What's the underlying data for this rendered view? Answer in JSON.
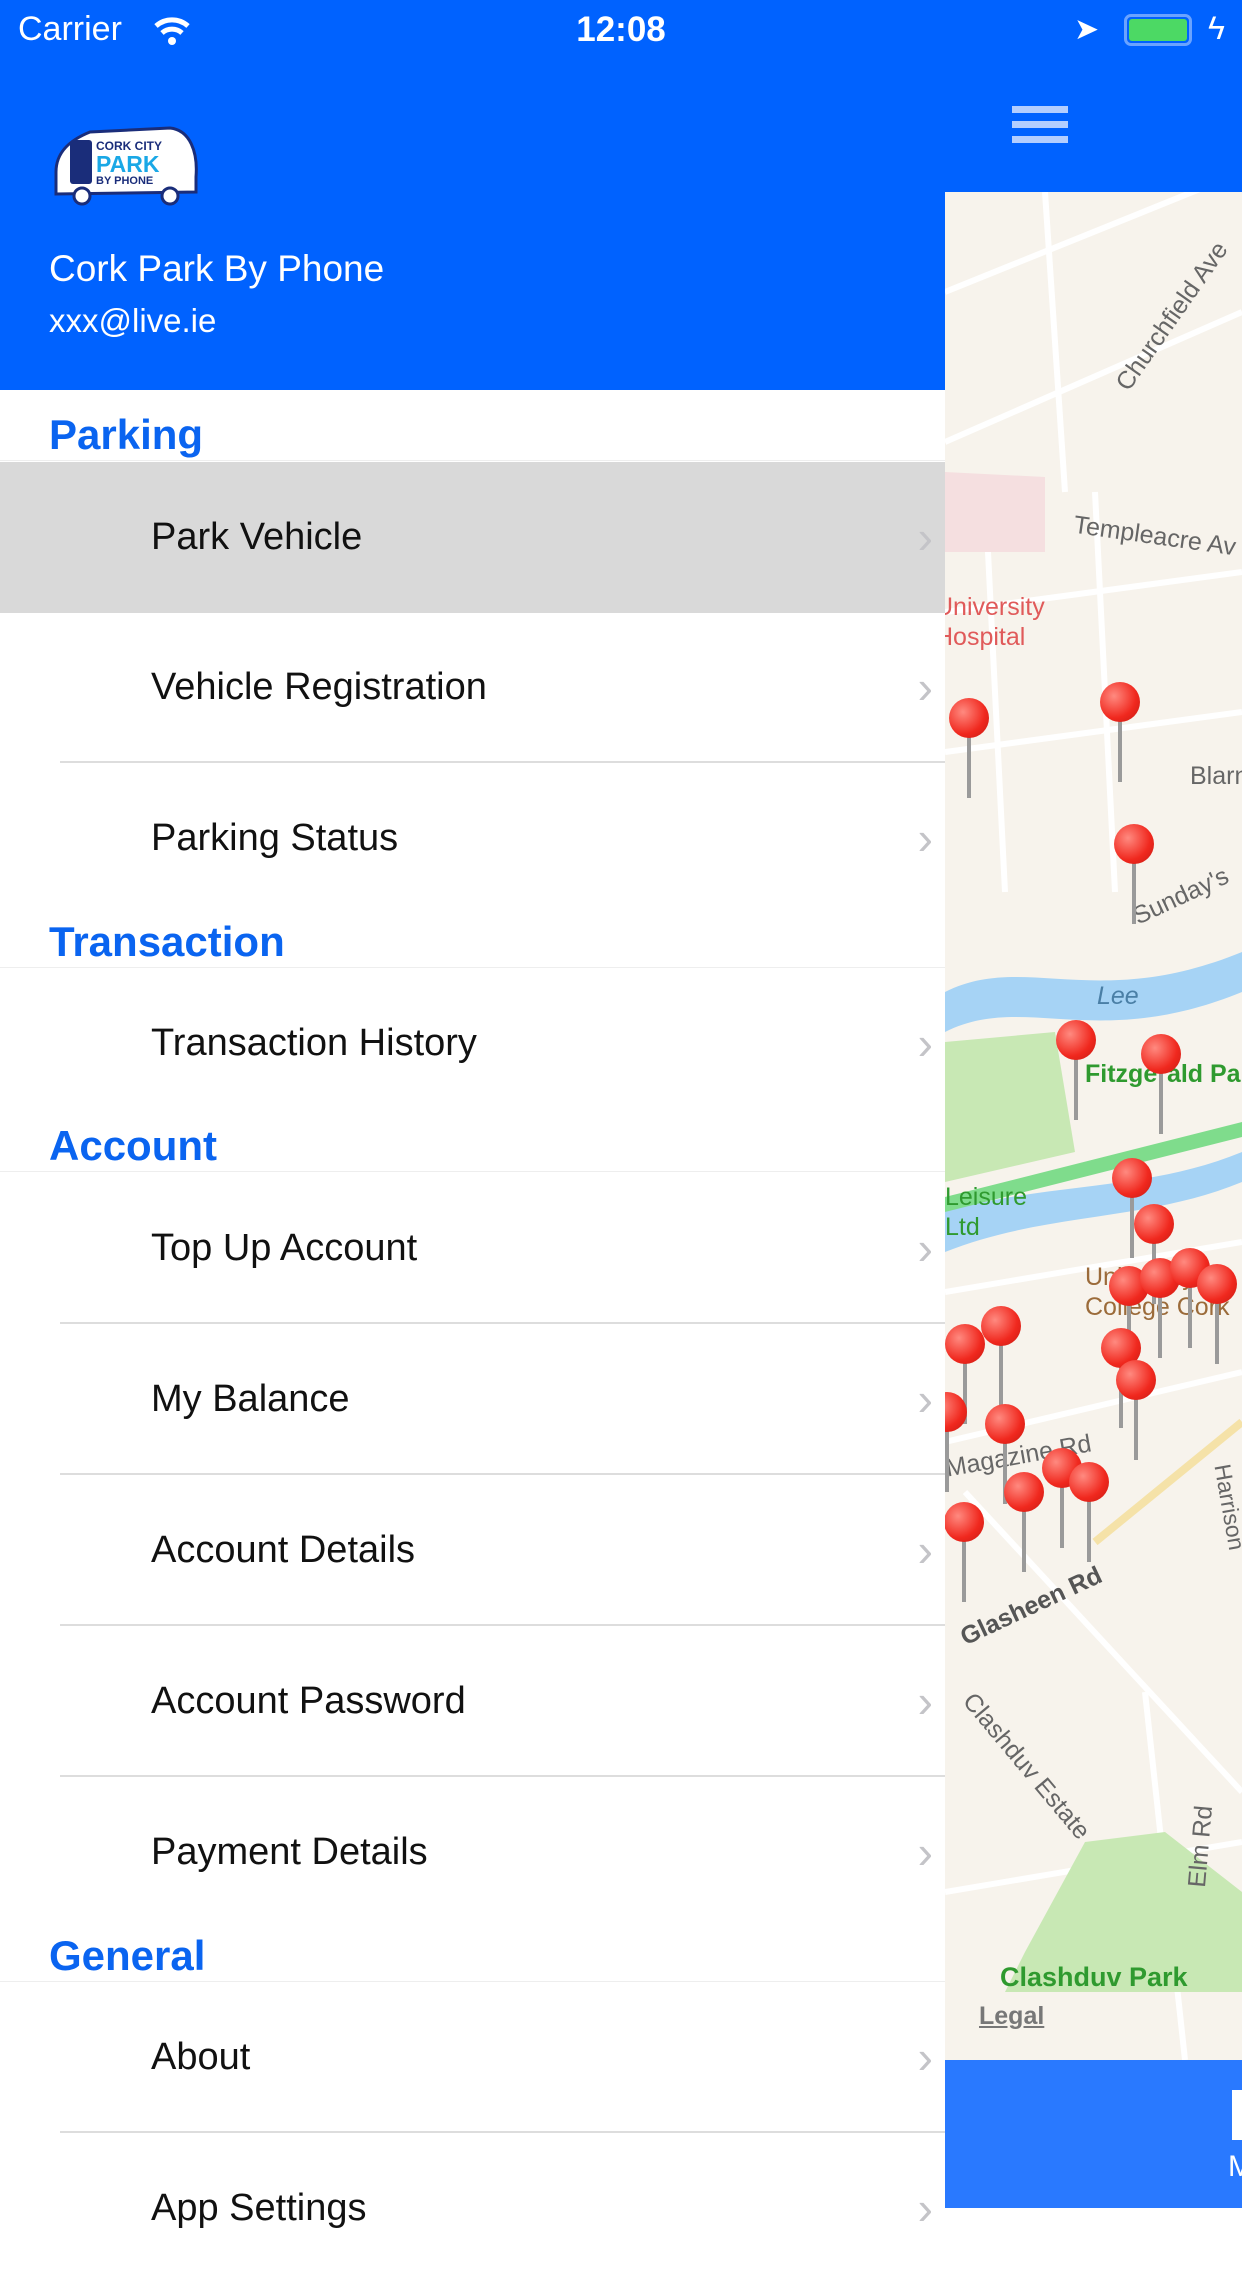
{
  "status_bar": {
    "carrier": "Carrier",
    "time": "12:08",
    "battery_color": "#4cd964"
  },
  "drawer": {
    "app_name": "Cork Park By Phone",
    "email": "xxx@live.ie",
    "logo_text": "CORK CITY PARK BY PHONE",
    "sections": [
      {
        "title": "Parking",
        "items": [
          "Park Vehicle",
          "Vehicle Registration",
          "Parking Status"
        ]
      },
      {
        "title": "Transaction",
        "items": [
          "Transaction History"
        ]
      },
      {
        "title": "Account",
        "items": [
          "Top Up Account",
          "My Balance",
          "Account Details",
          "Account Password",
          "Payment Details"
        ]
      },
      {
        "title": "General",
        "items": [
          "About",
          "App Settings"
        ]
      }
    ],
    "selected_item": "Park Vehicle"
  },
  "map": {
    "labels": [
      "Churchfield Ave",
      "Templeacre Av",
      "University Hospital",
      "Blarney",
      "Sunday's",
      "Lee",
      "Fitzgerald Park",
      "Leisure Ltd",
      "University College Cork",
      "Magazine Rd",
      "Glasheen Rd",
      "Clashduv Estate",
      "Elm Rd",
      "Clashduv Park",
      "Harrison"
    ],
    "legal": "Legal"
  },
  "bottom_bar": {
    "tab_label": "M"
  },
  "colors": {
    "primary": "#0062ff",
    "bottom_bar": "#2979ff",
    "section_title": "#0a64f0",
    "pin": "#f0281e"
  }
}
